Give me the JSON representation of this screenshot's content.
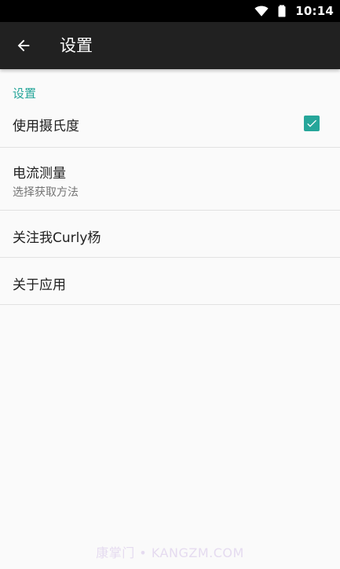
{
  "status_bar": {
    "time": "10:14",
    "icons": [
      "wifi-icon",
      "battery-icon"
    ]
  },
  "app_bar": {
    "back_icon": "arrow-back-icon",
    "title": "设置"
  },
  "preferences": {
    "category_title": "设置",
    "items": [
      {
        "title": "使用摄氏度",
        "checkbox_checked": true
      },
      {
        "title": "电流测量",
        "summary": "选择获取方法"
      },
      {
        "title": "关注我Curly杨"
      },
      {
        "title": "关于应用"
      }
    ]
  },
  "watermark": "康掌门 • KANGZM.COM",
  "colors": {
    "accent": "#26A69A",
    "app_bar": "#212121",
    "status_bar": "#000000",
    "background": "#FAFAFA",
    "primary_text": "#212121",
    "secondary_text": "#757575",
    "divider": "#E2E2E2"
  }
}
